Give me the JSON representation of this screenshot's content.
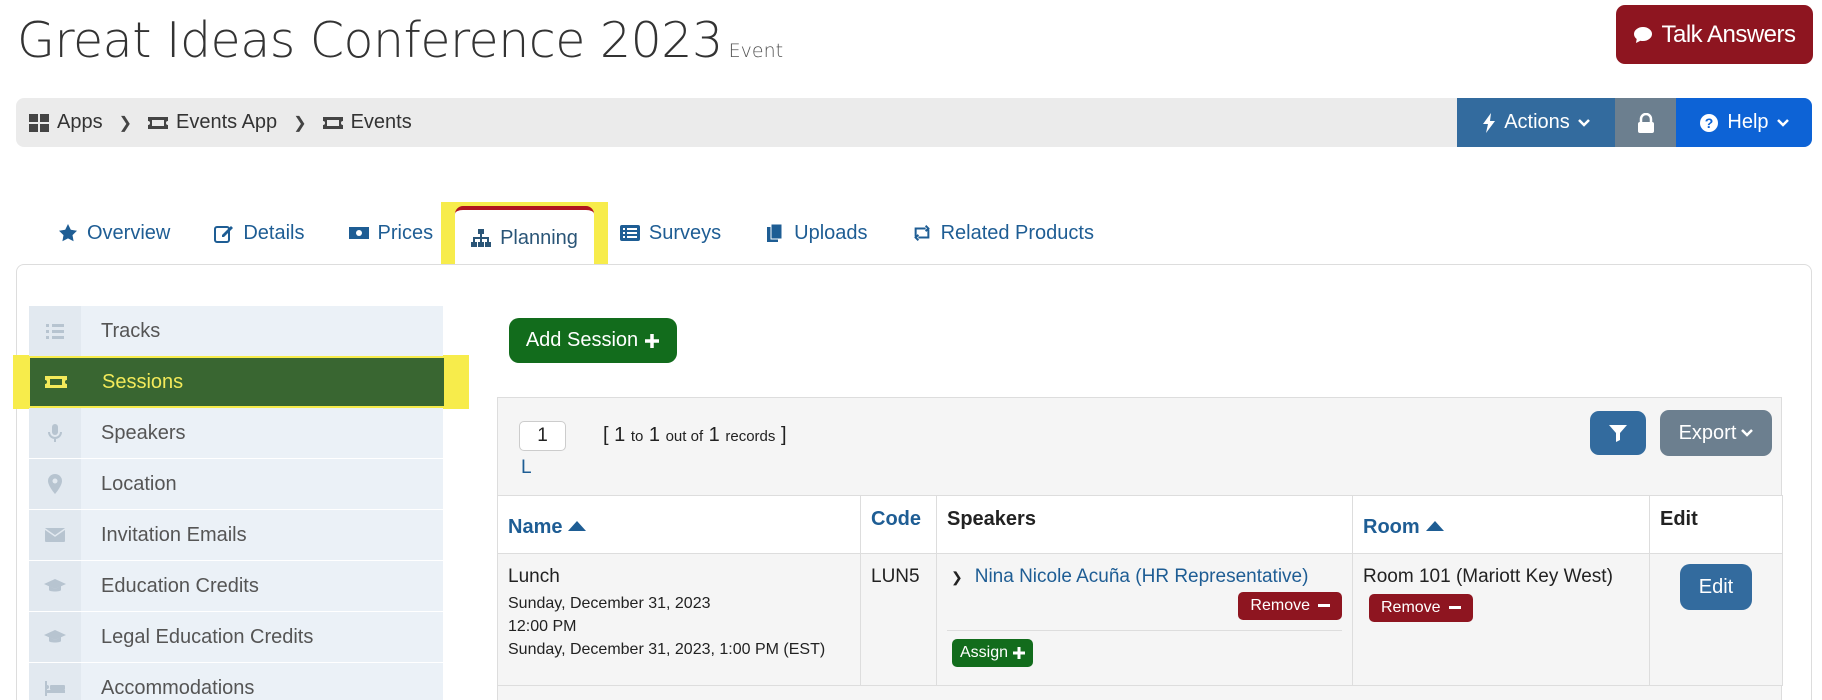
{
  "header": {
    "title": "Great Ideas Conference 2023",
    "subtitle": "Event",
    "talk_answers": "Talk Answers"
  },
  "breadcrumbs": [
    {
      "label": "Apps",
      "icon": "grid-icon"
    },
    {
      "label": "Events App",
      "icon": "ticket-icon"
    },
    {
      "label": "Events",
      "icon": "ticket-icon"
    }
  ],
  "toolbar": {
    "actions": "Actions",
    "help": "Help"
  },
  "tabs": [
    {
      "label": "Overview",
      "icon": "star-icon"
    },
    {
      "label": "Details",
      "icon": "edit-icon"
    },
    {
      "label": "Prices",
      "icon": "money-icon"
    },
    {
      "label": "Planning",
      "icon": "sitemap-icon"
    },
    {
      "label": "Surveys",
      "icon": "list-icon"
    },
    {
      "label": "Uploads",
      "icon": "files-icon"
    },
    {
      "label": "Related Products",
      "icon": "retweet-icon"
    }
  ],
  "sidebar": {
    "items": [
      {
        "label": "Tracks",
        "icon": "list-icon"
      },
      {
        "label": "Sessions",
        "icon": "ticket-icon"
      },
      {
        "label": "Speakers",
        "icon": "microphone-icon"
      },
      {
        "label": "Location",
        "icon": "map-marker-icon"
      },
      {
        "label": "Invitation Emails",
        "icon": "envelope-icon"
      },
      {
        "label": "Education Credits",
        "icon": "graduation-cap-icon"
      },
      {
        "label": "Legal Education Credits",
        "icon": "graduation-cap-icon"
      },
      {
        "label": "Accommodations",
        "icon": "bed-icon"
      }
    ],
    "active": "Sessions"
  },
  "grid": {
    "add_session": "Add Session",
    "page_value": "1",
    "records": {
      "open": "[",
      "from": "1",
      "to_word": "to",
      "to": "1",
      "out_of": "out of",
      "total": "1",
      "records_word": "records",
      "close": "]"
    },
    "page_link": "L",
    "export": "Export",
    "columns": {
      "name": "Name",
      "code": "Code",
      "speakers": "Speakers",
      "room": "Room",
      "edit": "Edit"
    },
    "rows": [
      {
        "name": "Lunch",
        "date": "Sunday, December 31, 2023",
        "time": "12:00 PM",
        "end": "Sunday, December 31, 2023, 1:00 PM (EST)",
        "code": "LUN5",
        "speaker": "Nina Nicole Acuña (HR Representative)",
        "remove": "Remove",
        "assign": "Assign",
        "room": "Room 101 (Mariott Key West)",
        "room_remove": "Remove",
        "edit": "Edit"
      }
    ]
  },
  "colors": {
    "primary": "#336b9e",
    "danger": "#8e1520",
    "success": "#126c1c",
    "highlight": "#f7ec4b",
    "help": "#0d63d6"
  }
}
